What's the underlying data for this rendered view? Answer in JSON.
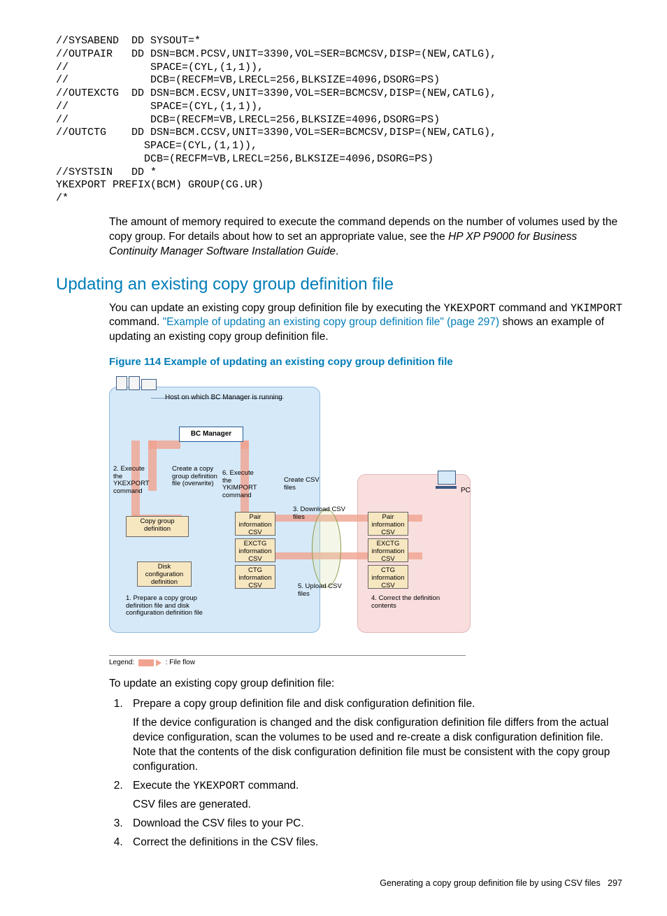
{
  "code": "//SYSABEND  DD SYSOUT=*\n//OUTPAIR   DD DSN=BCM.PCSV,UNIT=3390,VOL=SER=BCMCSV,DISP=(NEW,CATLG),\n//             SPACE=(CYL,(1,1)),\n//             DCB=(RECFM=VB,LRECL=256,BLKSIZE=4096,DSORG=PS)\n//OUTEXCTG  DD DSN=BCM.ECSV,UNIT=3390,VOL=SER=BCMCSV,DISP=(NEW,CATLG),\n//             SPACE=(CYL,(1,1)),\n//             DCB=(RECFM=VB,LRECL=256,BLKSIZE=4096,DSORG=PS)\n//OUTCTG    DD DSN=BCM.CCSV,UNIT=3390,VOL=SER=BCMCSV,DISP=(NEW,CATLG),\n              SPACE=(CYL,(1,1)),\n              DCB=(RECFM=VB,LRECL=256,BLKSIZE=4096,DSORG=PS)\n//SYSTSIN   DD *\nYKEXPORT PREFIX(BCM) GROUP(CG.UR)\n/*",
  "para_after_code": {
    "t1": "The amount of memory required to execute the command depends on the number of volumes used by the copy group. For details about how to set an appropriate value, see the ",
    "italic": "HP XP P9000 for Business Continuity Manager Software Installation Guide",
    "t2": "."
  },
  "heading": "Updating an existing copy group definition file",
  "para_intro": {
    "t1": "You can update an existing copy group definition file by executing the ",
    "c1": "YKEXPORT",
    "t2": " command and ",
    "c2": "YKIMPORT",
    "t3": " command. ",
    "link": "\"Example of updating an existing copy group definition file\" (page 297)",
    "t4": " shows an example of updating an existing copy group definition file."
  },
  "figure_caption": "Figure 114 Example of updating an existing copy group definition file",
  "diagram": {
    "host_label": "Host on which BC Manager is running",
    "pc_label": "PC",
    "bcmgr": "BC Manager",
    "ann_step2": "2. Execute the YKEXPORT command",
    "ann_create_def": "Create a copy group definition file (overwrite)",
    "ann_step6": "6. Execute the YKIMPORT command",
    "ann_create_csv": "Create CSV files",
    "box_copygroup": "Copy group definition",
    "box_diskconf": "Disk configuration definition",
    "box_pair1": "Pair information CSV",
    "box_exctg1": "EXCTG information CSV",
    "box_ctg1": "CTG information CSV",
    "box_pair2": "Pair information CSV",
    "box_exctg2": "EXCTG information CSV",
    "box_ctg2": "CTG information CSV",
    "ann_step1": "1. Prepare a copy group definition file and disk configuration definition file",
    "ann_step3": "3. Download CSV files",
    "ann_step5": "5. Upload CSV files",
    "ann_step4": "4. Correct the definition contents",
    "legend_label": "Legend:",
    "legend_text": ": File flow"
  },
  "steps_intro": "To update an existing copy group definition file:",
  "steps": {
    "s1": "Prepare a copy group definition file and disk configuration definition file.",
    "s1b": "If the device configuration is changed and the disk configuration definition file differs from the actual device configuration, scan the volumes to be used and re-create a disk configuration definition file. Note that the contents of the disk configuration definition file must be consistent with the copy group configuration.",
    "s2a": "Execute the ",
    "s2c": "YKEXPORT",
    "s2b": " command.",
    "s2d": "CSV files are generated.",
    "s3": "Download the CSV files to your PC.",
    "s4": "Correct the definitions in the CSV files."
  },
  "footer": {
    "text": "Generating a copy group definition file by using CSV files",
    "page": "297"
  }
}
